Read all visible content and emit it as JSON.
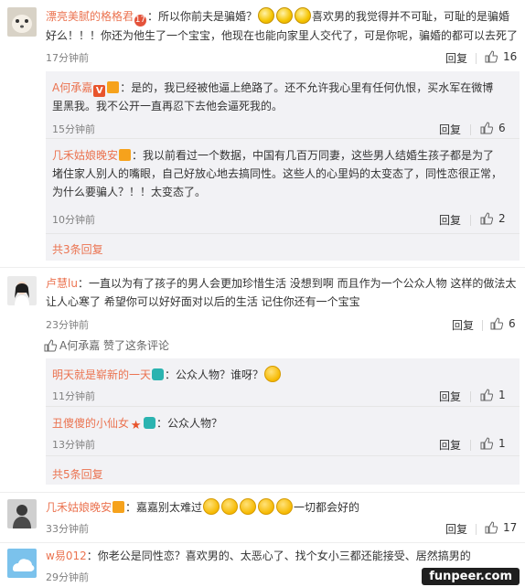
{
  "comments": [
    {
      "username": "漂亮美腻的格格君",
      "text_a": "：所以你前夫是骗婚？",
      "text_b": "喜欢男的我觉得并不可耻，可耻的是骗婚",
      "text_c": "好么！！！你还为他生了一个宝宝，他现在也能向家里人交代了，可是你呢，骗婚的都可以去死了",
      "time": "17分钟前",
      "reply": "回复",
      "likes": "16"
    },
    {
      "username": "卢慧lu",
      "text_a": "：一直以为有了孩子的男人会更加珍惜生活 没想到啊 而且作为一个公众人物 这样的做法太",
      "text_b": "让人心寒了 希望你可以好好面对以后的生活 记住你还有一个宝宝",
      "time": "23分钟前",
      "reply": "回复",
      "likes": "6",
      "liked_by": "A何承嘉 赞了这条评论"
    },
    {
      "username": "几禾姑娘晚安",
      "text_a": "：嘉嘉别太难过",
      "text_b": "一切都会好的",
      "time": "33分钟前",
      "reply": "回复",
      "likes": "17"
    },
    {
      "username": "w易012",
      "text_a": "：你老公是同性恋？喜欢男的、太恶心了、找个女小三都还能接受、居然搞男的",
      "time": "29分钟前"
    }
  ],
  "replies_1": [
    {
      "username": "A何承嘉",
      "text_a": "：是的，我已经被他逼上绝路了。还不允许我心里有任何仇恨，买水军在微博",
      "text_b": "里黑我。我不公开一直再忍下去他会逼死我的。",
      "time": "15分钟前",
      "reply": "回复",
      "likes": "6"
    },
    {
      "username": "几禾姑娘晚安",
      "text_a": "：我以前看过一个数据，中国有几百万同妻，这些男人结婚生孩子都是为了",
      "text_b": "堵住家人别人的嘴眼，自己好放心地去搞同性。这些人的心里妈的太变态了，同性恋很正常，",
      "text_c": "为什么要骗人？！！太变态了。",
      "time": "10分钟前",
      "reply": "回复",
      "likes": "2"
    }
  ],
  "more_1": "共3条回复",
  "replies_2": [
    {
      "username": "明天就是崭新的一天",
      "text_a": "：公众人物？谁呀？",
      "time": "11分钟前",
      "reply": "回复",
      "likes": "1"
    },
    {
      "username": "丑傻傻的小仙女",
      "text_a": "：公众人物？",
      "time": "13分钟前",
      "reply": "回复",
      "likes": "1"
    }
  ],
  "more_2": "共5条回复",
  "watermark": "funpeer.com",
  "colors": {
    "username": "#eb7350",
    "subbox": "#f2f2f5",
    "text": "#333333",
    "time": "#808080"
  }
}
